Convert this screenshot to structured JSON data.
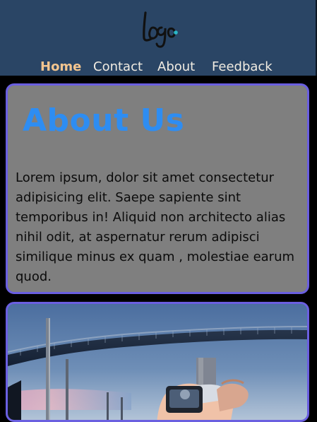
{
  "header": {
    "logo_text": "Logo."
  },
  "nav": {
    "items": [
      {
        "label": "Home",
        "active": true
      },
      {
        "label": "Contact",
        "active": false
      },
      {
        "label": "About",
        "active": false
      },
      {
        "label": "Feedback",
        "active": false
      }
    ]
  },
  "about": {
    "title": "About Us",
    "body": "Lorem ipsum, dolor sit amet consectetur adipisicing elit. Saepe sapiente sint temporibus in! Aliquid non architecto alias nihil odit, at aspernatur rerum adipisci similique minus ex quam , molestiae earum quod."
  },
  "photo": {
    "subject": "overpass-and-camera-photo"
  },
  "colors": {
    "header_bg": "#2a4565",
    "page_bg": "#000000",
    "card_bg": "#7f7f7f",
    "card_border": "#6a5fe0",
    "title": "#2e8df2",
    "nav_active": "#f3c58f",
    "nav_text": "#f1ece2"
  }
}
